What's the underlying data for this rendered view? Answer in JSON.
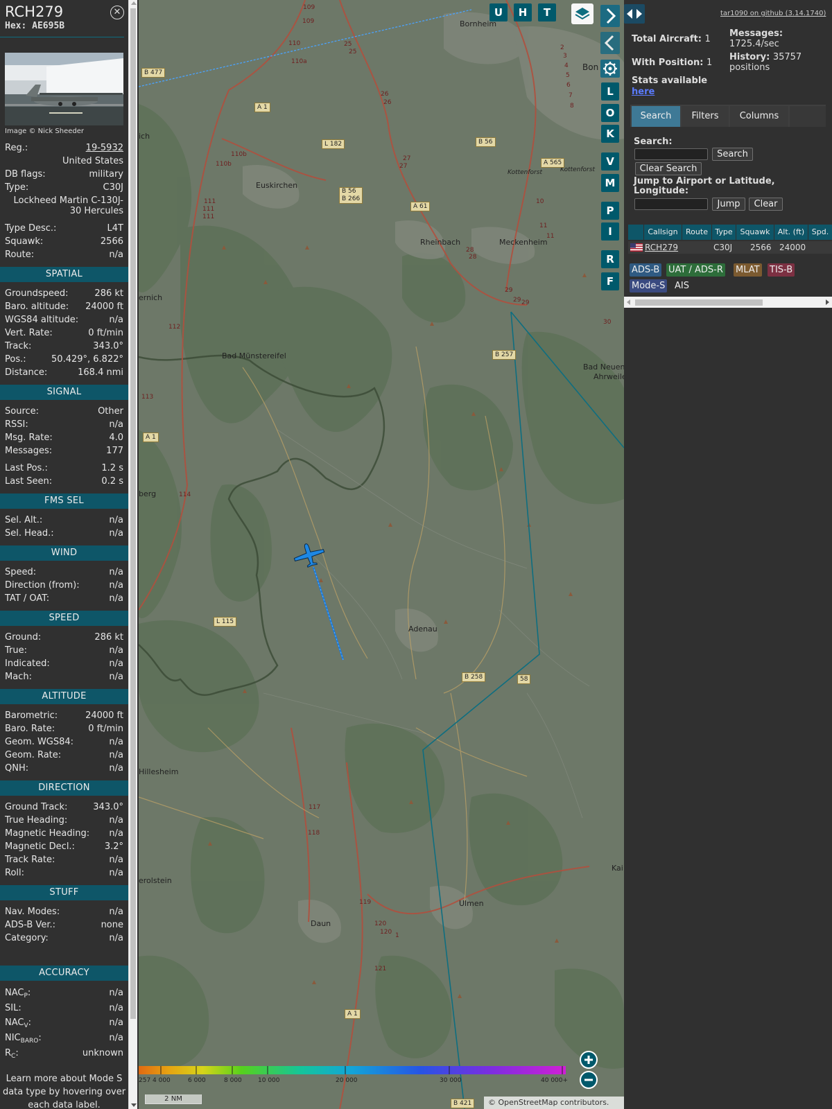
{
  "selected": {
    "callsign": "RCH279",
    "hex": "Hex: AE695B",
    "photo_credit": "Image © Nick Sheeder",
    "reg_label": "Reg.:",
    "reg": "19-5932",
    "country": "United States",
    "dbflags_label": "DB flags:",
    "dbflags": "military",
    "type_label": "Type:",
    "type": "C30J",
    "type_full": "Lockheed Martin C-130J-30 Hercules",
    "typedesc_label": "Type Desc.:",
    "typedesc": "L4T",
    "squawk_label": "Squawk:",
    "squawk": "2566",
    "route_label": "Route:",
    "route": "n/a"
  },
  "spatial": {
    "title": "SPATIAL",
    "groundspeed_label": "Groundspeed:",
    "groundspeed": "286 kt",
    "baroalt_label": "Baro. altitude:",
    "baroalt": "24000 ft",
    "wgs84_label": "WGS84 altitude:",
    "wgs84": "n/a",
    "vertrate_label": "Vert. Rate:",
    "vertrate": "0 ft/min",
    "track_label": "Track:",
    "track": "343.0°",
    "pos_label": "Pos.:",
    "pos": "50.429°, 6.822°",
    "distance_label": "Distance:",
    "distance": "168.4 nmi"
  },
  "signal": {
    "title": "SIGNAL",
    "source_label": "Source:",
    "source": "Other",
    "rssi_label": "RSSI:",
    "rssi": "n/a",
    "msgrate_label": "Msg. Rate:",
    "msgrate": "4.0",
    "messages_label": "Messages:",
    "messages": "177",
    "lastpos_label": "Last Pos.:",
    "lastpos": "1.2 s",
    "lastseen_label": "Last Seen:",
    "lastseen": "0.2 s"
  },
  "fmssel": {
    "title": "FMS SEL",
    "selalt_label": "Sel. Alt.:",
    "selalt": "n/a",
    "selhead_label": "Sel. Head.:",
    "selhead": "n/a"
  },
  "wind": {
    "title": "WIND",
    "speed_label": "Speed:",
    "speed": "n/a",
    "dir_label": "Direction (from):",
    "dir": "n/a",
    "tat_label": "TAT / OAT:",
    "tat": "n/a"
  },
  "speed": {
    "title": "SPEED",
    "ground_label": "Ground:",
    "ground": "286 kt",
    "true_label": "True:",
    "true": "n/a",
    "indicated_label": "Indicated:",
    "indicated": "n/a",
    "mach_label": "Mach:",
    "mach": "n/a"
  },
  "altitude": {
    "title": "ALTITUDE",
    "baro_label": "Barometric:",
    "baro": "24000 ft",
    "barorate_label": "Baro. Rate:",
    "barorate": "0 ft/min",
    "geom_label": "Geom. WGS84:",
    "geom": "n/a",
    "geomrate_label": "Geom. Rate:",
    "geomrate": "n/a",
    "qnh_label": "QNH:",
    "qnh": "n/a"
  },
  "direction": {
    "title": "DIRECTION",
    "groundtrack_label": "Ground Track:",
    "groundtrack": "343.0°",
    "trueheading_label": "True Heading:",
    "trueheading": "n/a",
    "magheading_label": "Magnetic Heading:",
    "magheading": "n/a",
    "magdecl_label": "Magnetic Decl.:",
    "magdecl": "3.2°",
    "trackrate_label": "Track Rate:",
    "trackrate": "n/a",
    "roll_label": "Roll:",
    "roll": "n/a"
  },
  "stuff": {
    "title": "STUFF",
    "navmodes_label": "Nav. Modes:",
    "navmodes": "n/a",
    "adsbver_label": "ADS-B Ver.:",
    "adsbver": "none",
    "category_label": "Category:",
    "category": "n/a"
  },
  "accuracy": {
    "title": "ACCURACY",
    "nacp_main": "NAC",
    "nacp_sub": "P",
    "nacp": "n/a",
    "sil_label": "SIL:",
    "sil": "n/a",
    "nacv_main": "NAC",
    "nacv_sub": "V",
    "nacv": "n/a",
    "nicbaro_main": "NIC",
    "nicbaro_sub": "BARO",
    "nicbaro": "n/a",
    "rc_main": "R",
    "rc_sub": "C",
    "rc": "unknown",
    "colon": ":"
  },
  "learn_more": "Learn more about Mode S data type by hovering over each data label.",
  "map": {
    "buttons": [
      "U",
      "H",
      "T"
    ],
    "side_buttons": [
      "L",
      "O",
      "K",
      "V",
      "M",
      "P",
      "I",
      "R",
      "F"
    ],
    "places": [
      "Bornheim",
      "Bon",
      "Euskirchen",
      "Rheinbach",
      "Meckenheim",
      "Bad Münstereifel",
      "Bad Neuen",
      "Ahrweile",
      "Adenau",
      "Hillesheim",
      "erolstein",
      "Daun",
      "Ulmen",
      "Kai",
      "ich",
      "ernich",
      "berg",
      "Kottenforst",
      "Kottenforst"
    ],
    "roads": [
      "B 477",
      "A 1",
      "L 182",
      "B 56",
      "B 56",
      "B 266",
      "A 61",
      "A 565",
      "B 257",
      "A 1",
      "L 115",
      "B 258",
      "58",
      "A 1",
      "B 421"
    ],
    "road_nums": [
      "109",
      "110",
      "109",
      "110a",
      "25",
      "25",
      "26",
      "26",
      "27",
      "27",
      "28",
      "28",
      "29",
      "29",
      "30",
      "29",
      "112",
      "113",
      "114",
      "110b",
      "111",
      "111",
      "111",
      "110b",
      "10",
      "11",
      "11",
      "2",
      "3",
      "4",
      "5",
      "6",
      "7",
      "8",
      "117",
      "118",
      "119",
      "120",
      "120",
      "121",
      "1"
    ],
    "scale_nm": "2 NM",
    "alt_ticks": [
      "4 000",
      "6 000",
      "8 000",
      "10 000",
      "20 000",
      "30 000",
      "40 000+"
    ],
    "alt_tick_left": "257",
    "attribution_symbol": "©",
    "attribution_link": "OpenStreetMap",
    "attribution_rest": " contributors.",
    "colors": {
      "track": "#1f7ad6",
      "aircraft": "#1e88e5",
      "range_ring": "#0e6e80"
    }
  },
  "panel": {
    "github": "tar1090 on github (3.14.1740)",
    "total_label": "Total Aircraft:",
    "total": "1",
    "withpos_label": "With Position:",
    "withpos": "1",
    "messages_label": "Messages:",
    "messages": "1725.4/sec",
    "history_label": "History:",
    "history": "35757 positions",
    "stats_label": "Stats available",
    "stats_link": "here",
    "tabs": [
      "Search",
      "Filters",
      "Columns"
    ],
    "search_label": "Search:",
    "search_value": "",
    "search_button": "Search",
    "clear_search_button": "Clear Search",
    "jump_label": "Jump to Airport or Latitude, Longitude:",
    "jump_value": "",
    "jump_button": "Jump",
    "clear_button": "Clear",
    "table": {
      "headers": [
        "Callsign",
        "Route",
        "Type",
        "Squawk",
        "Alt. (ft)",
        "Spd."
      ],
      "rows": [
        {
          "callsign": "RCH279",
          "route": "",
          "type": "C30J",
          "squawk": "2566",
          "alt": "24000"
        }
      ]
    },
    "legend": [
      "ADS-B",
      "UAT / ADS-R",
      "MLAT",
      "TIS-B",
      "Mode-S",
      "AIS"
    ],
    "legend_colors": [
      "#2f5a82",
      "#2d6d3a",
      "#7b5a30",
      "#7c3042",
      "#3a4a80",
      "#303030"
    ]
  }
}
